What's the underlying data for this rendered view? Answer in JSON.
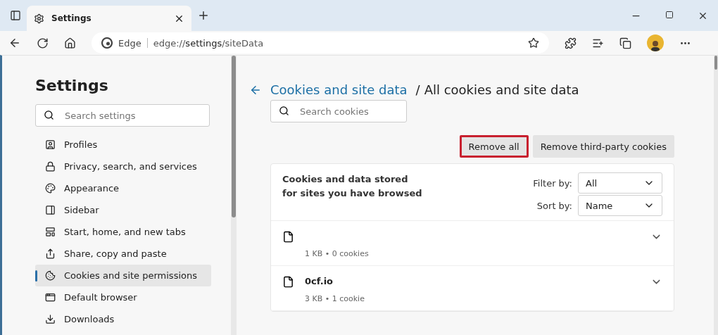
{
  "tab": {
    "title": "Settings",
    "selected": true
  },
  "address_bar": {
    "brand": "Edge",
    "url_prefix": "edge://",
    "url_bold": "settings",
    "url_suffix": "/siteData"
  },
  "sidebar": {
    "title": "Settings",
    "search": {
      "placeholder": "Search settings"
    },
    "items": [
      {
        "label": "Profiles",
        "selected": false
      },
      {
        "label": "Privacy, search, and services",
        "selected": false
      },
      {
        "label": "Appearance",
        "selected": false
      },
      {
        "label": "Sidebar",
        "selected": false
      },
      {
        "label": "Start, home, and new tabs",
        "selected": false
      },
      {
        "label": "Share, copy and paste",
        "selected": false
      },
      {
        "label": "Cookies and site permissions",
        "selected": true
      },
      {
        "label": "Default browser",
        "selected": false
      },
      {
        "label": "Downloads",
        "selected": false
      }
    ]
  },
  "main": {
    "breadcrumb_link": "Cookies and site data",
    "breadcrumb_separator": "/",
    "page_title": "All cookies and site data",
    "search": {
      "placeholder": "Search cookies"
    },
    "buttons": [
      {
        "label": "Remove all",
        "highlighted": true
      },
      {
        "label": "Remove third-party cookies",
        "highlighted": false
      }
    ],
    "card": {
      "description": "Cookies and data stored for sites you have browsed",
      "filter": {
        "label": "Filter by:",
        "value": "All"
      },
      "sort": {
        "label": "Sort by:",
        "value": "Name"
      },
      "sites": [
        {
          "detail": "1 KB • 0 cookies",
          "expanded": false
        },
        {
          "name": "0cf.io",
          "detail": "3 KB • 1 cookie",
          "expanded": false
        }
      ]
    }
  }
}
